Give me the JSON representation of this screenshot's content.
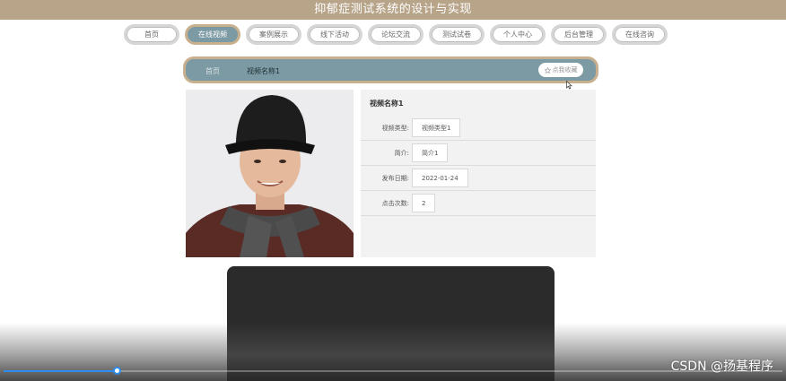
{
  "header": {
    "title": "抑郁症测试系统的设计与实现"
  },
  "nav": {
    "items": [
      {
        "label": "首页",
        "active": false
      },
      {
        "label": "在线视频",
        "active": true
      },
      {
        "label": "案例展示",
        "active": false
      },
      {
        "label": "线下活动",
        "active": false
      },
      {
        "label": "论坛交流",
        "active": false
      },
      {
        "label": "测试试卷",
        "active": false
      },
      {
        "label": "个人中心",
        "active": false
      },
      {
        "label": "后台管理",
        "active": false
      },
      {
        "label": "在线咨询",
        "active": false
      }
    ]
  },
  "breadcrumb": {
    "home": "首页",
    "current": "视频名称1"
  },
  "favorite": {
    "label": "点我收藏",
    "icon": "star-icon"
  },
  "video_info": {
    "title": "视频名称1",
    "rows": [
      {
        "label": "视频类型:",
        "value": "视频类型1"
      },
      {
        "label": "简介:",
        "value": "简介1"
      },
      {
        "label": "发布日期:",
        "value": "2022-01-24"
      },
      {
        "label": "点击次数:",
        "value": "2"
      }
    ]
  },
  "player": {
    "progress": 0.145
  },
  "watermark": "CSDN @扬基程序",
  "colors": {
    "brand": "#b7a489",
    "accent": "#7c9aa3",
    "progress": "#2d8cf0"
  }
}
